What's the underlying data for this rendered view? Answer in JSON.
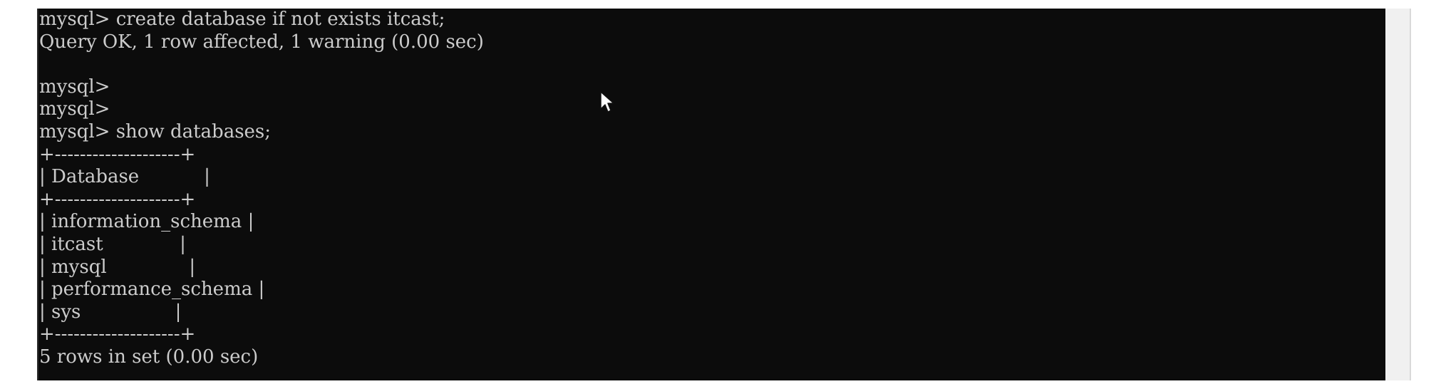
{
  "terminal": {
    "lines": [
      "mysql> create database if not exists itcast;",
      "Query OK, 1 row affected, 1 warning (0.00 sec)",
      "",
      "mysql>",
      "mysql>",
      "mysql> show databases;",
      "+--------------------+",
      "| Database           |",
      "+--------------------+",
      "| information_schema |",
      "| itcast             |",
      "| mysql              |",
      "| performance_schema |",
      "| sys                |",
      "+--------------------+",
      "5 rows in set (0.00 sec)"
    ]
  },
  "colors": {
    "background": "#0c0c0c",
    "text": "#cccccc",
    "scrollbar": "#f0f0f0"
  },
  "icons": {
    "cursor": "mouse-pointer-icon"
  }
}
